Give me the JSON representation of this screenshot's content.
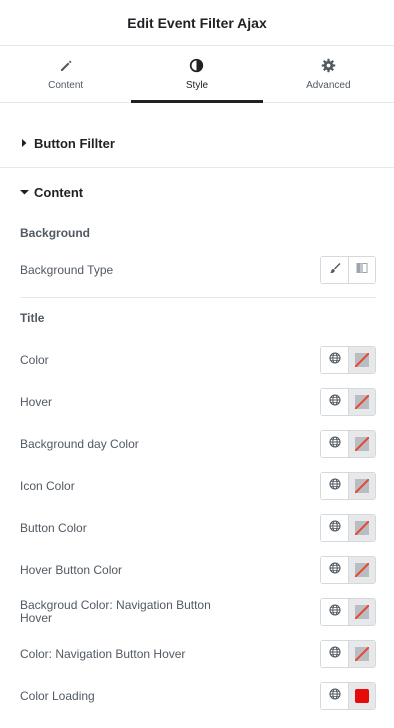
{
  "header": {
    "title": "Edit Event Filter Ajax"
  },
  "tabs": [
    {
      "label": "Content",
      "icon": "pencil-icon"
    },
    {
      "label": "Style",
      "icon": "contrast-icon"
    },
    {
      "label": "Advanced",
      "icon": "gear-icon"
    }
  ],
  "active_tab": "Style",
  "sections": {
    "button_filter": {
      "title": "Button Fillter",
      "state": "collapsed"
    },
    "content": {
      "title": "Content",
      "state": "expanded"
    }
  },
  "background": {
    "group_label": "Background",
    "type_label": "Background Type",
    "type_options": [
      "brush-icon",
      "gradient-icon"
    ]
  },
  "title_group": {
    "label": "Title",
    "controls": [
      {
        "label": "Color",
        "swatch": "none"
      },
      {
        "label": "Hover",
        "swatch": "none"
      },
      {
        "label": "Background day Color",
        "swatch": "none"
      },
      {
        "label": "Icon Color",
        "swatch": "none"
      },
      {
        "label": "Button Color",
        "swatch": "none"
      },
      {
        "label": "Hover Button Color",
        "swatch": "none"
      },
      {
        "label": "Backgroud Color: Navigation Button Hover",
        "swatch": "none"
      },
      {
        "label": "Color: Navigation Button Hover",
        "swatch": "none"
      },
      {
        "label": "Color Loading",
        "swatch": "#e60b0b"
      }
    ]
  },
  "colors": {
    "accent": "#1f2124",
    "label": "#515962",
    "border": "#d5d8dc",
    "loading_swatch": "#e60b0b",
    "empty_slash": "#e8452f"
  }
}
